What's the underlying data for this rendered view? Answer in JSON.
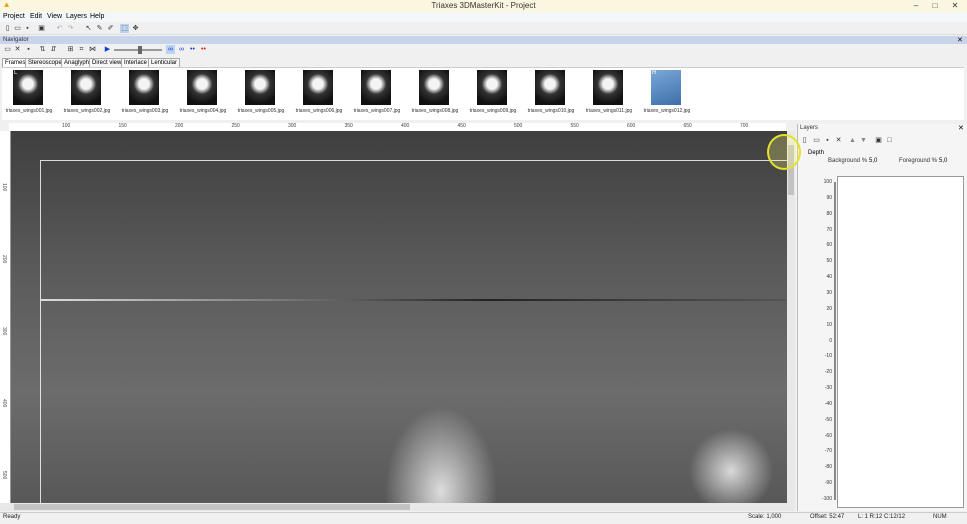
{
  "window": {
    "title": "Triaxes 3DMasterKit - Project",
    "min": "–",
    "max": "□",
    "close": "✕"
  },
  "menu": [
    "Project",
    "Edit",
    "View",
    "Layers",
    "Help"
  ],
  "navigator": {
    "label": "Navigator"
  },
  "tabs": [
    "Frames",
    "Stereoscope",
    "Anaglyph",
    "Direct view",
    "Interlace",
    "Lenticular"
  ],
  "frames": [
    {
      "caption": "triaxes_wings001.jpg",
      "marker": "L"
    },
    {
      "caption": "triaxes_wings002.jpg",
      "marker": ""
    },
    {
      "caption": "triaxes_wings003.jpg",
      "marker": ""
    },
    {
      "caption": "triaxes_wings004.jpg",
      "marker": ""
    },
    {
      "caption": "triaxes_wings005.jpg",
      "marker": ""
    },
    {
      "caption": "triaxes_wings006.jpg",
      "marker": ""
    },
    {
      "caption": "triaxes_wings007.jpg",
      "marker": ""
    },
    {
      "caption": "triaxes_wings008.jpg",
      "marker": ""
    },
    {
      "caption": "triaxes_wings009.jpg",
      "marker": ""
    },
    {
      "caption": "triaxes_wings010.jpg",
      "marker": ""
    },
    {
      "caption": "triaxes_wings011.jpg",
      "marker": ""
    },
    {
      "caption": "triaxes_wings012.jpg",
      "marker": "R"
    }
  ],
  "hruler_ticks": [
    "100",
    "150",
    "200",
    "250",
    "300",
    "350",
    "400",
    "450",
    "500",
    "550",
    "600",
    "650",
    "700"
  ],
  "vruler_ticks": [
    "100",
    "200",
    "300",
    "400",
    "500"
  ],
  "layers": {
    "header": "Layers",
    "depth_label": "Depth",
    "background_label": "Background %",
    "background_value": "5,0",
    "foreground_label": "Foreground %",
    "foreground_value": "5,0",
    "scale": [
      "100",
      "90",
      "80",
      "70",
      "60",
      "50",
      "40",
      "30",
      "20",
      "10",
      "0",
      "-10",
      "-20",
      "-30",
      "-40",
      "-50",
      "-60",
      "-70",
      "-80",
      "-90",
      "-100"
    ]
  },
  "status": {
    "ready": "Ready",
    "scale": "Scale: 1,000",
    "offset": "Offset: 52:47",
    "frames": "L: 1  R:12  C:12/12",
    "num": "NUM"
  }
}
